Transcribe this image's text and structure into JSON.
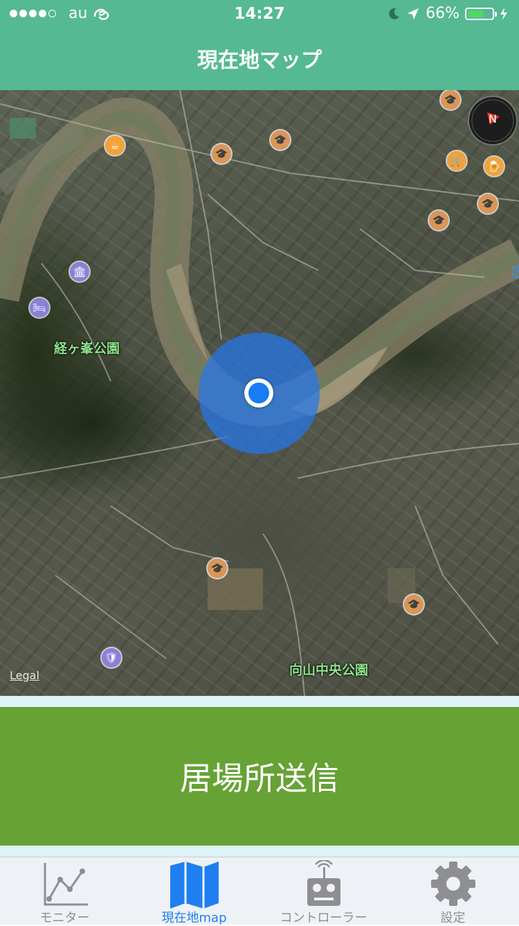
{
  "status_bar": {
    "carrier": "au",
    "time": "14:27",
    "battery_percent": "66%",
    "battery_level": 0.66,
    "signal_bars_filled": 4,
    "signal_bars_total": 5
  },
  "nav": {
    "title": "現在地マップ"
  },
  "map": {
    "labels": [
      {
        "text": "経ヶ峯公園"
      },
      {
        "text": "向山中央公園"
      }
    ],
    "legal": "Legal",
    "edge_text": "広",
    "compass_label": "N"
  },
  "send_button": {
    "label": "居場所送信"
  },
  "tabs": [
    {
      "label": "モニター",
      "icon": "line-chart-icon"
    },
    {
      "label": "現在地map",
      "icon": "map-icon"
    },
    {
      "label": "コントローラー",
      "icon": "remote-controller-icon"
    },
    {
      "label": "設定",
      "icon": "gear-icon"
    }
  ],
  "colors": {
    "header": "#55b993",
    "send_button": "#67a235",
    "tab_active": "#1f7ff0",
    "tab_inactive": "#8e8e93",
    "location_dot": "#1a7cf5"
  }
}
